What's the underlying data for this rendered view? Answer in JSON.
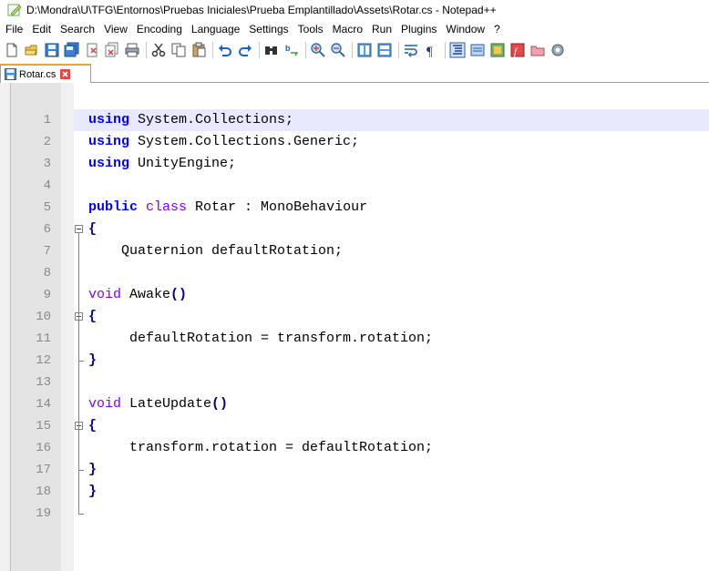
{
  "window": {
    "title": "D:\\Mondra\\U\\TFG\\Entornos\\Pruebas Iniciales\\Prueba Emplantillado\\Assets\\Rotar.cs - Notepad++"
  },
  "menu": [
    "File",
    "Edit",
    "Search",
    "View",
    "Encoding",
    "Language",
    "Settings",
    "Tools",
    "Macro",
    "Run",
    "Plugins",
    "Window",
    "?"
  ],
  "toolbar": {
    "icons": [
      "new-file-icon",
      "open-file-icon",
      "save-icon",
      "save-all-icon",
      "close-icon",
      "close-all-icon",
      "print-icon",
      "sep",
      "cut-icon",
      "copy-icon",
      "paste-icon",
      "sep",
      "undo-icon",
      "redo-icon",
      "sep",
      "find-icon",
      "replace-icon",
      "sep",
      "zoom-in-icon",
      "zoom-out-icon",
      "sep",
      "sync-vertical-icon",
      "sync-horizontal-icon",
      "sep",
      "word-wrap-icon",
      "show-all-chars-icon",
      "sep",
      "indent-guide-icon",
      "lang-icon",
      "doc-map-icon",
      "function-list-icon",
      "folder-icon",
      "monitor-icon"
    ]
  },
  "tab": {
    "label": "Rotar.cs",
    "close_icon": "close-tab-icon"
  },
  "editor": {
    "lines": [
      {
        "n": "1",
        "tokens": [
          {
            "t": "using",
            "c": "kw"
          },
          {
            "t": " System.Collections;",
            "c": "pl"
          }
        ]
      },
      {
        "n": "2",
        "tokens": [
          {
            "t": "using",
            "c": "kw"
          },
          {
            "t": " System.Collections.Generic;",
            "c": "pl"
          }
        ]
      },
      {
        "n": "3",
        "tokens": [
          {
            "t": "using",
            "c": "kw"
          },
          {
            "t": " UnityEngine;",
            "c": "pl"
          }
        ]
      },
      {
        "n": "4",
        "tokens": []
      },
      {
        "n": "5",
        "tokens": [
          {
            "t": "public",
            "c": "kw"
          },
          {
            "t": " ",
            "c": "pl"
          },
          {
            "t": "class",
            "c": "ty"
          },
          {
            "t": " Rotar : MonoBehaviour",
            "c": "pl"
          }
        ]
      },
      {
        "n": "6",
        "tokens": [
          {
            "t": "{",
            "c": "op"
          }
        ]
      },
      {
        "n": "7",
        "tokens": [
          {
            "t": "    Quaternion defaultRotation;",
            "c": "pl"
          }
        ]
      },
      {
        "n": "8",
        "tokens": []
      },
      {
        "n": "9",
        "tokens": [
          {
            "t": "void",
            "c": "ty"
          },
          {
            "t": " Awake",
            "c": "pl"
          },
          {
            "t": "()",
            "c": "op"
          }
        ]
      },
      {
        "n": "10",
        "tokens": [
          {
            "t": "{",
            "c": "op"
          }
        ]
      },
      {
        "n": "11",
        "tokens": [
          {
            "t": "     defaultRotation = transform.rotation;",
            "c": "pl"
          }
        ]
      },
      {
        "n": "12",
        "tokens": [
          {
            "t": "}",
            "c": "op"
          }
        ]
      },
      {
        "n": "13",
        "tokens": []
      },
      {
        "n": "14",
        "tokens": [
          {
            "t": "void",
            "c": "ty"
          },
          {
            "t": " LateUpdate",
            "c": "pl"
          },
          {
            "t": "()",
            "c": "op"
          }
        ]
      },
      {
        "n": "15",
        "tokens": [
          {
            "t": "{",
            "c": "op"
          }
        ]
      },
      {
        "n": "16",
        "tokens": [
          {
            "t": "     transform.rotation = defaultRotation;",
            "c": "pl"
          }
        ]
      },
      {
        "n": "17",
        "tokens": [
          {
            "t": "}",
            "c": "op"
          }
        ]
      },
      {
        "n": "18",
        "tokens": [
          {
            "t": "}",
            "c": "op"
          }
        ]
      },
      {
        "n": "19",
        "tokens": []
      }
    ]
  }
}
